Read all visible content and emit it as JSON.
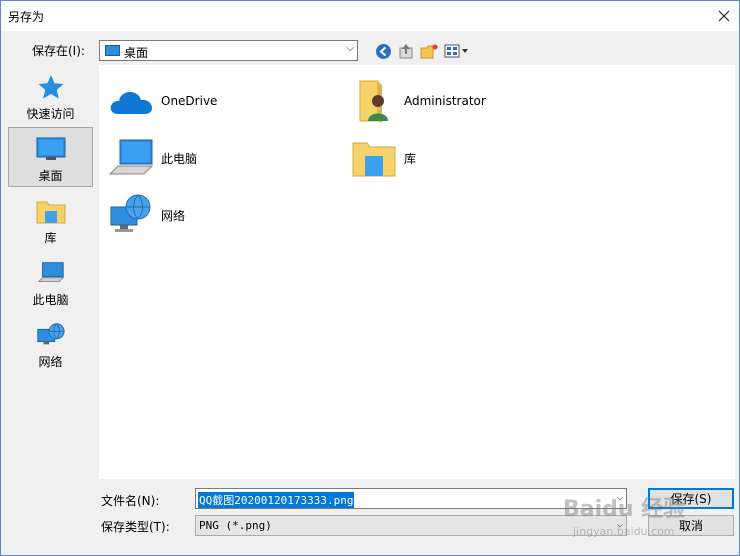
{
  "window": {
    "title": "另存为"
  },
  "toolbar": {
    "save_in_label": "保存在(I):",
    "save_in_value": "桌面",
    "buttons": [
      "back-icon",
      "up-folder-icon",
      "new-folder-icon",
      "view-menu-icon"
    ]
  },
  "places": [
    {
      "label": "快速访问",
      "icon": "quick-access-star-icon"
    },
    {
      "label": "桌面",
      "icon": "desktop-icon",
      "selected": true
    },
    {
      "label": "库",
      "icon": "library-folder-icon"
    },
    {
      "label": "此电脑",
      "icon": "this-pc-icon"
    },
    {
      "label": "网络",
      "icon": "network-icon"
    }
  ],
  "items": [
    {
      "label": "OneDrive",
      "icon": "onedrive-cloud-icon"
    },
    {
      "label": "Administrator",
      "icon": "user-folder-icon"
    },
    {
      "label": "此电脑",
      "icon": "this-pc-icon"
    },
    {
      "label": "库",
      "icon": "library-folder-icon"
    },
    {
      "label": "网络",
      "icon": "network-icon"
    }
  ],
  "form": {
    "filename_label": "文件名(N):",
    "filename_value": "QQ截图20200120173333.png",
    "filetype_label": "保存类型(T):",
    "filetype_value": "PNG (*.png)",
    "save_button": "保存(S)",
    "cancel_button": "取消"
  },
  "watermark": {
    "main": "Baidu 经验",
    "sub": "jingyan.baidu.com"
  },
  "colors": {
    "accent": "#0078d7",
    "folder": "#f6d26b",
    "monitor": "#2d8ee0"
  }
}
